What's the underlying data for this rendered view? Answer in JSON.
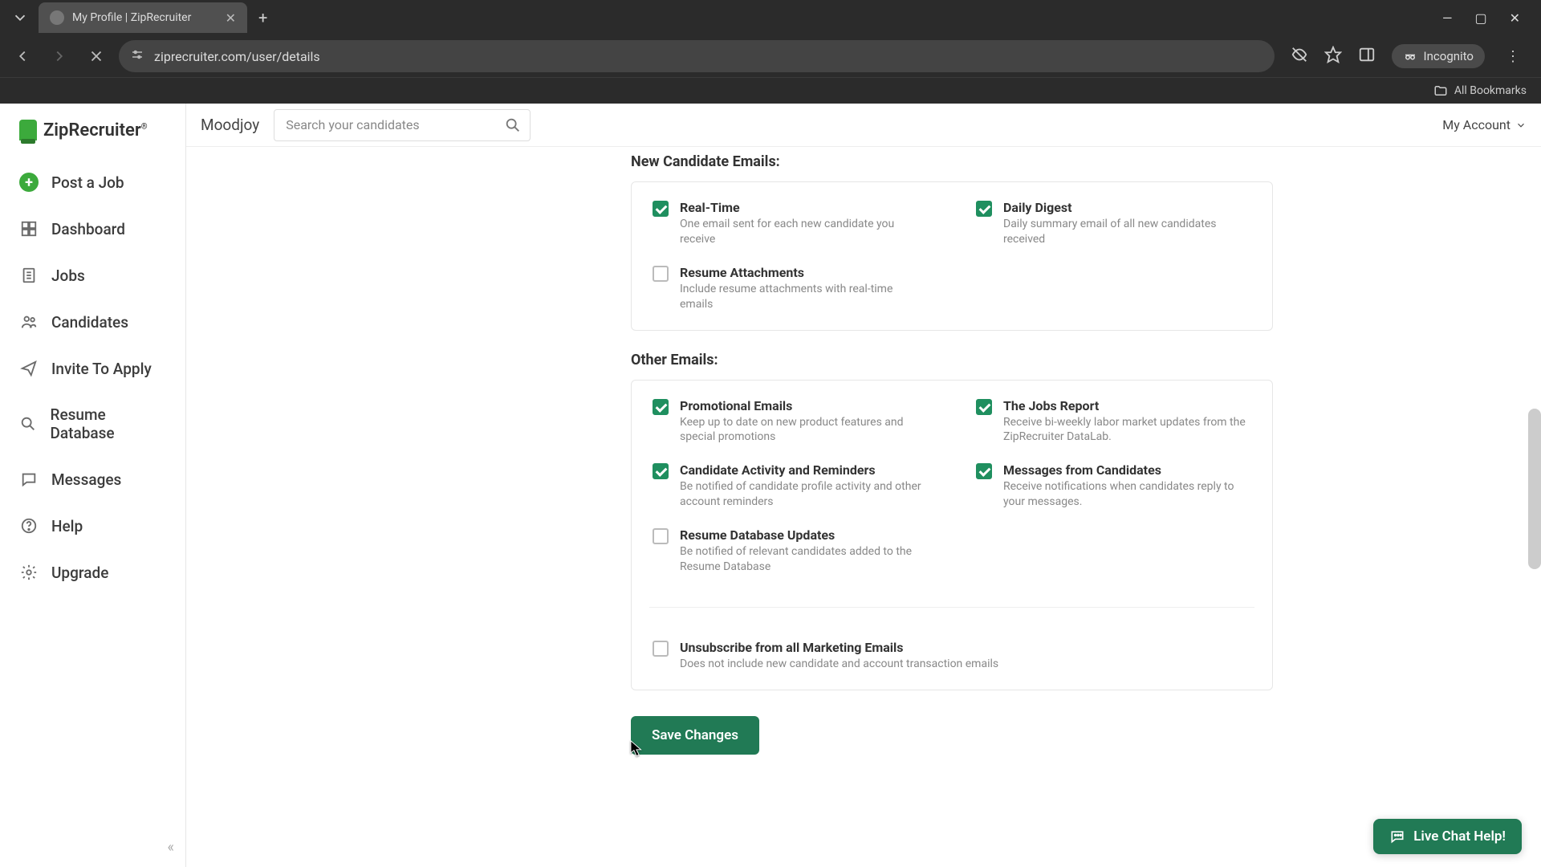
{
  "browser": {
    "tab_title": "My Profile | ZipRecruiter",
    "url": "ziprecruiter.com/user/details",
    "incognito_label": "Incognito",
    "all_bookmarks": "All Bookmarks"
  },
  "brand": {
    "name": "ZipRecruiter"
  },
  "sidebar": {
    "items": [
      {
        "label": "Post a Job"
      },
      {
        "label": "Dashboard"
      },
      {
        "label": "Jobs"
      },
      {
        "label": "Candidates"
      },
      {
        "label": "Invite To Apply"
      },
      {
        "label": "Resume Database"
      },
      {
        "label": "Messages"
      },
      {
        "label": "Help"
      },
      {
        "label": "Upgrade"
      }
    ]
  },
  "topbar": {
    "org": "Moodjoy",
    "search_placeholder": "Search your candidates",
    "account_label": "My Account"
  },
  "sections": {
    "new_candidate_title": "New Candidate Emails:",
    "other_emails_title": "Other Emails:"
  },
  "options": {
    "realtime": {
      "title": "Real-Time",
      "desc": "One email sent for each new candidate you receive",
      "checked": true
    },
    "daily_digest": {
      "title": "Daily Digest",
      "desc": "Daily summary email of all new candidates received",
      "checked": true
    },
    "resume_attachments": {
      "title": "Resume Attachments",
      "desc": "Include resume attachments with real-time emails",
      "checked": false
    },
    "promotional": {
      "title": "Promotional Emails",
      "desc": "Keep up to date on new product features and special promotions",
      "checked": true
    },
    "jobs_report": {
      "title": "The Jobs Report",
      "desc": "Receive bi-weekly labor market updates from the ZipRecruiter DataLab.",
      "checked": true
    },
    "activity_reminders": {
      "title": "Candidate Activity and Reminders",
      "desc": "Be notified of candidate profile activity and other account reminders",
      "checked": true
    },
    "messages_from_candidates": {
      "title": "Messages from Candidates",
      "desc": "Receive notifications when candidates reply to your messages.",
      "checked": true
    },
    "resume_db_updates": {
      "title": "Resume Database Updates",
      "desc": "Be notified of relevant candidates added to the Resume Database",
      "checked": false
    },
    "unsubscribe_all": {
      "title": "Unsubscribe from all Marketing Emails",
      "desc": "Does not include new candidate and account transaction emails",
      "checked": false
    }
  },
  "buttons": {
    "save": "Save Changes"
  },
  "chat": {
    "label": "Live Chat Help!"
  }
}
